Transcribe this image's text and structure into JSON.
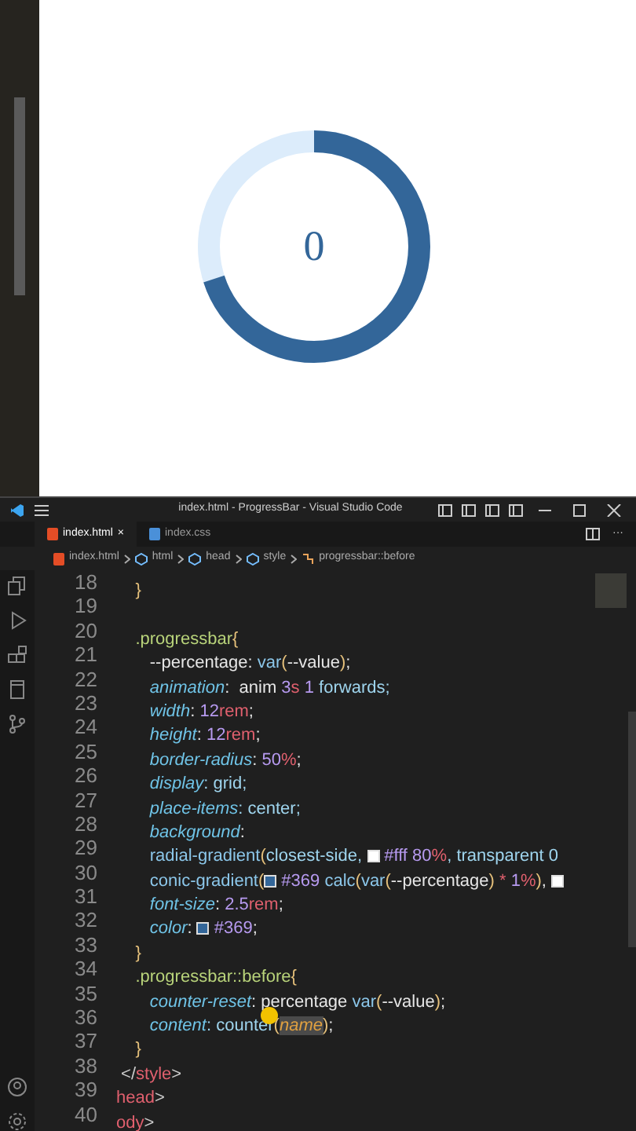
{
  "preview": {
    "progress": {
      "reading": "0",
      "level": 0.7
    }
  },
  "window": {
    "title": "index.html - ProgressBar - Visual Studio Code"
  },
  "tabs": [
    {
      "label": "index.html",
      "kind": "html",
      "selected": true,
      "close": "×"
    },
    {
      "label": "index.css",
      "kind": "css",
      "selected": false
    }
  ],
  "editor_actions": {
    "more": "···"
  },
  "breadcrumbs": [
    {
      "label": "index.html",
      "kind": "html"
    },
    {
      "label": "html",
      "kind": "element"
    },
    {
      "label": "head",
      "kind": "element"
    },
    {
      "label": "style",
      "kind": "element"
    },
    {
      "label": "progressbar::before",
      "kind": "selector"
    }
  ],
  "code_lines": [
    {
      "number": "18",
      "tokens": [
        {
          "text": "    }",
          "kind": "brace"
        }
      ]
    },
    {
      "number": "19"
    },
    {
      "number": "20",
      "tokens": [
        {
          "text": "    .progressbar",
          "kind": "selector"
        },
        {
          "text": "{",
          "kind": "brace"
        }
      ]
    },
    {
      "number": "21",
      "tokens": [
        {
          "text": "       --percentage: ",
          "kind": "plain"
        },
        {
          "text": "var",
          "kind": "func"
        },
        {
          "text": "(",
          "kind": "brace"
        },
        {
          "text": "--value",
          "kind": "plain"
        },
        {
          "text": ")",
          "kind": "brace"
        },
        {
          "text": ";",
          "kind": "plain"
        }
      ]
    },
    {
      "number": "22",
      "tokens": [
        {
          "text": "       animation",
          "kind": "prop"
        },
        {
          "text": ":  anim ",
          "kind": "plain"
        },
        {
          "text": "3",
          "kind": "num"
        },
        {
          "text": "s",
          "kind": "unit"
        },
        {
          "text": " 1",
          "kind": "num"
        },
        {
          "text": " forwards;",
          "kind": "value"
        }
      ]
    },
    {
      "number": "23",
      "tokens": [
        {
          "text": "       width",
          "kind": "prop"
        },
        {
          "text": ": ",
          "kind": "plain"
        },
        {
          "text": "12",
          "kind": "num"
        },
        {
          "text": "rem",
          "kind": "unit"
        },
        {
          "text": ";",
          "kind": "plain"
        }
      ]
    },
    {
      "number": "24",
      "tokens": [
        {
          "text": "       height",
          "kind": "prop"
        },
        {
          "text": ": ",
          "kind": "plain"
        },
        {
          "text": "12",
          "kind": "num"
        },
        {
          "text": "rem",
          "kind": "unit"
        },
        {
          "text": ";",
          "kind": "plain"
        }
      ]
    },
    {
      "number": "25",
      "tokens": [
        {
          "text": "       border-radius",
          "kind": "prop"
        },
        {
          "text": ": ",
          "kind": "plain"
        },
        {
          "text": "50",
          "kind": "num"
        },
        {
          "text": "%",
          "kind": "unit"
        },
        {
          "text": ";",
          "kind": "plain"
        }
      ]
    },
    {
      "number": "26",
      "tokens": [
        {
          "text": "       display",
          "kind": "prop"
        },
        {
          "text": ": grid;",
          "kind": "value"
        }
      ]
    },
    {
      "number": "27",
      "tokens": [
        {
          "text": "       place-items",
          "kind": "prop"
        },
        {
          "text": ": center;",
          "kind": "value"
        }
      ]
    },
    {
      "number": "28",
      "tokens": [
        {
          "text": "       background",
          "kind": "prop"
        },
        {
          "text": ":",
          "kind": "plain"
        }
      ]
    },
    {
      "number": "29",
      "tokens": [
        {
          "text": "       radial-gradient",
          "kind": "func"
        },
        {
          "text": "(",
          "kind": "brace"
        },
        {
          "text": "closest-side, ",
          "kind": "value"
        },
        {
          "kind": "swatch",
          "color": "#ffffff"
        },
        {
          "text": "#fff ",
          "kind": "num"
        },
        {
          "text": "80",
          "kind": "num"
        },
        {
          "text": "%",
          "kind": "unit"
        },
        {
          "text": ", transparent 0",
          "kind": "value"
        }
      ]
    },
    {
      "number": "30",
      "tokens": [
        {
          "text": "       conic-gradient",
          "kind": "func"
        },
        {
          "text": "(",
          "kind": "brace"
        },
        {
          "kind": "swatch",
          "color": "#336699"
        },
        {
          "text": "#369 ",
          "kind": "num"
        },
        {
          "text": "calc",
          "kind": "func"
        },
        {
          "text": "(",
          "kind": "brace"
        },
        {
          "text": "var",
          "kind": "func"
        },
        {
          "text": "(",
          "kind": "brace"
        },
        {
          "text": "--percentage",
          "kind": "plain"
        },
        {
          "text": ")",
          "kind": "brace"
        },
        {
          "text": " * ",
          "kind": "unit"
        },
        {
          "text": "1",
          "kind": "num"
        },
        {
          "text": "%",
          "kind": "unit"
        },
        {
          "text": ")",
          "kind": "brace"
        },
        {
          "text": ", ",
          "kind": "plain"
        },
        {
          "kind": "swatch",
          "color": "#ffffff"
        }
      ]
    },
    {
      "number": "31",
      "tokens": [
        {
          "text": "       font-size",
          "kind": "prop"
        },
        {
          "text": ": ",
          "kind": "plain"
        },
        {
          "text": "2.5",
          "kind": "num"
        },
        {
          "text": "rem",
          "kind": "unit"
        },
        {
          "text": ";",
          "kind": "plain"
        }
      ]
    },
    {
      "number": "32",
      "tokens": [
        {
          "text": "       color",
          "kind": "prop"
        },
        {
          "text": ": ",
          "kind": "plain"
        },
        {
          "kind": "swatch",
          "color": "#336699"
        },
        {
          "text": "#369",
          "kind": "num"
        },
        {
          "text": ";",
          "kind": "plain"
        }
      ]
    },
    {
      "number": "33",
      "tokens": [
        {
          "text": "    }",
          "kind": "brace"
        }
      ]
    },
    {
      "number": "34",
      "tokens": [
        {
          "text": "    .progressbar::before",
          "kind": "selector"
        },
        {
          "text": "{",
          "kind": "brace"
        }
      ]
    },
    {
      "number": "35",
      "tokens": [
        {
          "text": "       counter-reset",
          "kind": "prop"
        },
        {
          "text": ": percentage ",
          "kind": "plain"
        },
        {
          "text": "var",
          "kind": "func"
        },
        {
          "text": "(",
          "kind": "brace"
        },
        {
          "text": "--value",
          "kind": "plain"
        },
        {
          "text": ")",
          "kind": "brace"
        },
        {
          "text": ";",
          "kind": "plain"
        }
      ]
    },
    {
      "number": "36",
      "tokens": [
        {
          "text": "       content",
          "kind": "prop"
        },
        {
          "text": ": counter",
          "kind": "value"
        },
        {
          "text": "(",
          "kind": "brace"
        },
        {
          "text": "name",
          "kind": "highlight"
        },
        {
          "text": ")",
          "kind": "brace"
        },
        {
          "text": ";",
          "kind": "plain"
        }
      ]
    },
    {
      "number": "37",
      "tokens": [
        {
          "text": "    }",
          "kind": "brace"
        }
      ]
    },
    {
      "number": "38",
      "tokens": [
        {
          "text": " </",
          "kind": "punct"
        },
        {
          "text": "style",
          "kind": "tag"
        },
        {
          "text": ">",
          "kind": "punct"
        }
      ]
    },
    {
      "number": "39",
      "tokens": [
        {
          "text": "head",
          "kind": "tag"
        },
        {
          "text": ">",
          "kind": "punct"
        }
      ]
    },
    {
      "number": "40",
      "tokens": [
        {
          "text": "ody",
          "kind": "tag"
        },
        {
          "text": ">",
          "kind": "punct"
        }
      ]
    }
  ]
}
